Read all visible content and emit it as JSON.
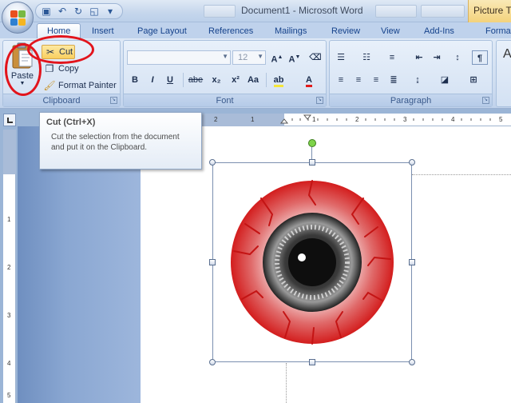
{
  "window": {
    "title": "Document1 - Microsoft Word",
    "picture_tools": "Picture To"
  },
  "tabs": [
    {
      "label": "Home",
      "active": true
    },
    {
      "label": "Insert"
    },
    {
      "label": "Page Layout"
    },
    {
      "label": "References"
    },
    {
      "label": "Mailings"
    },
    {
      "label": "Review"
    },
    {
      "label": "View"
    },
    {
      "label": "Add-Ins"
    },
    {
      "label": "Format"
    }
  ],
  "clipboard": {
    "paste_label": "Paste",
    "cut_label": "Cut",
    "copy_label": "Copy",
    "format_painter_label": "Format Painter",
    "group_label": "Clipboard"
  },
  "font": {
    "font_name": "",
    "font_size": "12",
    "group_label": "Font",
    "buttons": [
      "B",
      "I",
      "U",
      "abe",
      "x₂",
      "x²",
      "Aa"
    ]
  },
  "paragraph": {
    "group_label": "Paragraph"
  },
  "tooltip": {
    "title": "Cut (Ctrl+X)",
    "body": "Cut the selection from the document and put it on the Clipboard."
  },
  "ruler": {
    "h_numbers": [
      "2",
      "1",
      "1",
      "2",
      "3",
      "4",
      "5"
    ],
    "v_numbers": [
      "1",
      "2",
      "3",
      "4",
      "5"
    ]
  },
  "icons": [
    "office-button",
    "save-icon",
    "undo-icon",
    "redo-icon",
    "print-preview-icon",
    "paste-icon",
    "cut-icon",
    "copy-icon",
    "format-painter-icon"
  ],
  "colors": {
    "annotation": "#e2141c",
    "ribbon": "#d3e1f3",
    "tab_text": "#15428b",
    "eye_red": "#d31d1d"
  }
}
